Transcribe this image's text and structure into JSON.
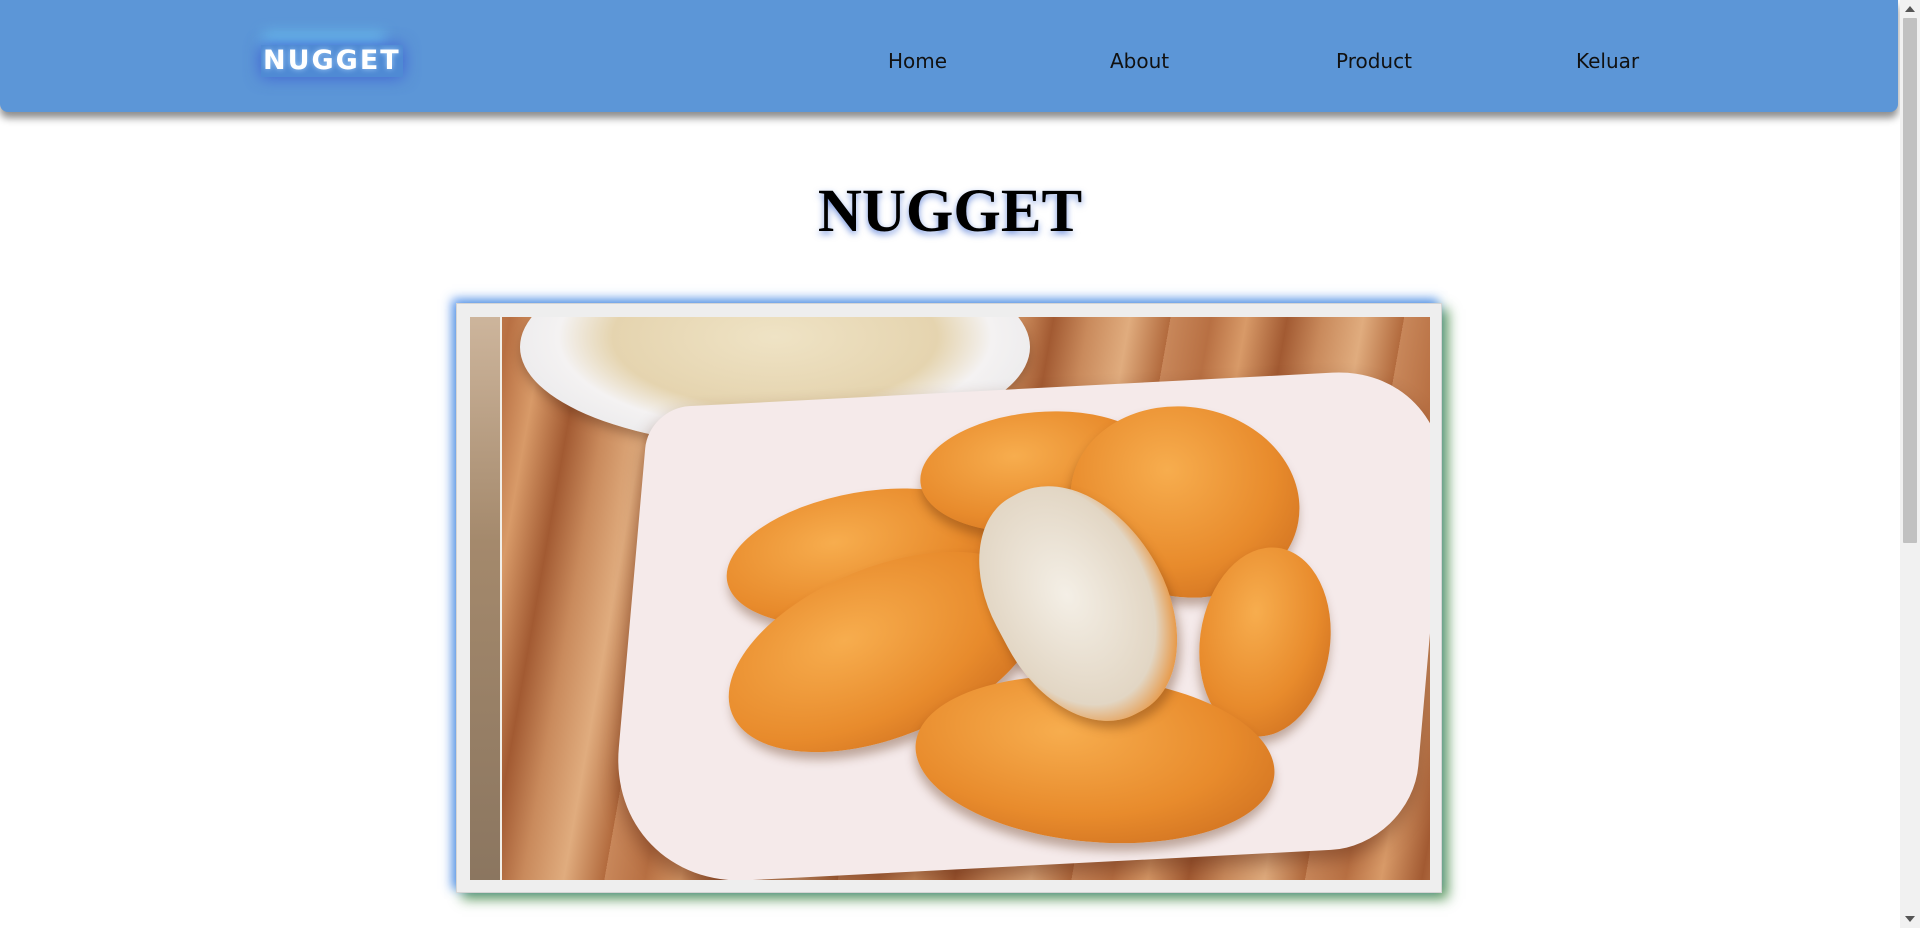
{
  "navbar": {
    "logo": "NUGGET",
    "links": [
      {
        "label": "Home"
      },
      {
        "label": "About"
      },
      {
        "label": "Product"
      },
      {
        "label": "Keluar"
      }
    ],
    "background_color": "#5c96d7"
  },
  "main": {
    "title": "NUGGET",
    "image": {
      "subject": "chicken nuggets on a white plate with a dip bowl on a wooden board"
    }
  },
  "colors": {
    "navbar": "#5c96d7",
    "logo_bg": "#4f8ad4",
    "frame_shadow_top": "#3c82eb",
    "frame_shadow_bottom": "#287828"
  }
}
